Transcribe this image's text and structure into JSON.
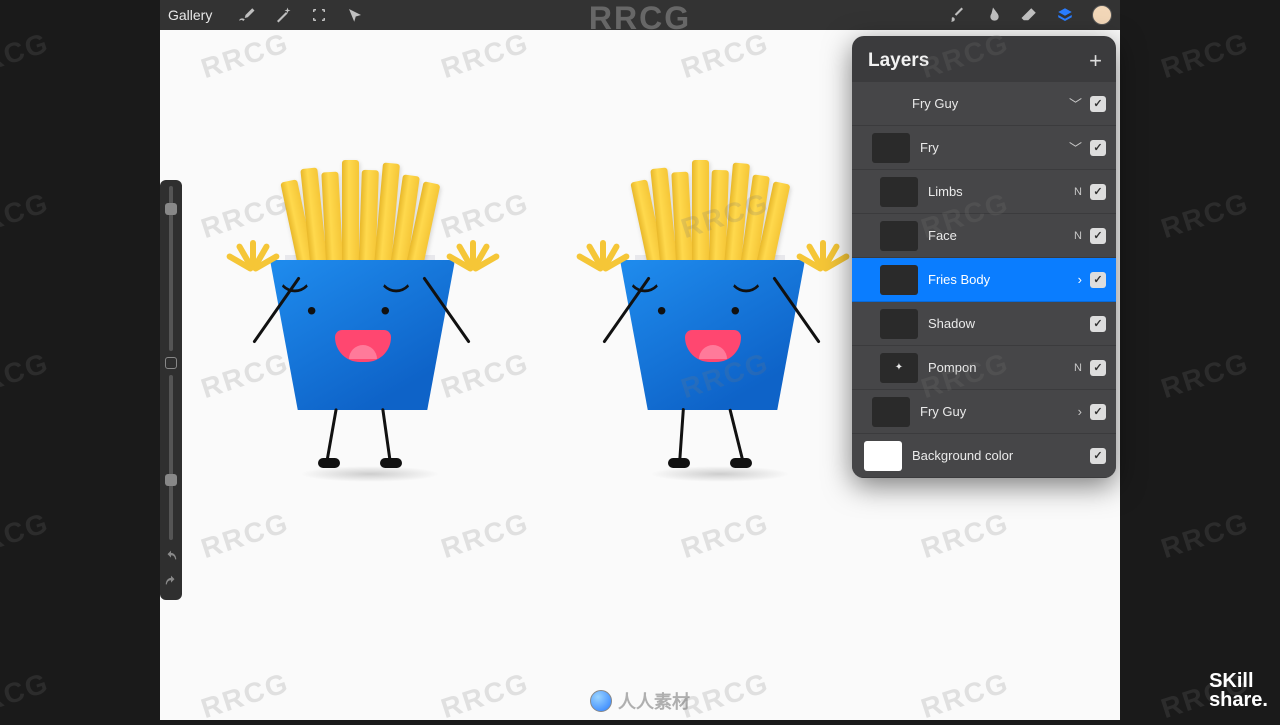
{
  "toolbar": {
    "gallery_label": "Gallery"
  },
  "layers_panel": {
    "title": "Layers",
    "items": [
      {
        "name": "Fry Guy",
        "indent": 0,
        "indicator": "chevron-down",
        "selected": false
      },
      {
        "name": "Fry",
        "indent": 1,
        "indicator": "chevron-down",
        "selected": false
      },
      {
        "name": "Limbs",
        "indent": 2,
        "indicator": "N",
        "selected": false
      },
      {
        "name": "Face",
        "indent": 2,
        "indicator": "N",
        "selected": false
      },
      {
        "name": "Fries Body",
        "indent": 2,
        "indicator": "chevron-right",
        "selected": true
      },
      {
        "name": "Shadow",
        "indent": 2,
        "indicator": "",
        "selected": false
      },
      {
        "name": "Pompon",
        "indent": 2,
        "indicator": "N",
        "selected": false
      },
      {
        "name": "Fry Guy",
        "indent": 1,
        "indicator": "chevron-right",
        "selected": false
      },
      {
        "name": "Background color",
        "indent": 0,
        "indicator": "",
        "selected": false
      }
    ]
  },
  "watermarks": {
    "top": "RRCG",
    "tiled": "RRCG",
    "bottom_center": "人人素材",
    "bottom_right_line1": "SKill",
    "bottom_right_line2": "share."
  },
  "colors": {
    "accent": "#0a7dff",
    "current_color": "#f2d7b8"
  }
}
